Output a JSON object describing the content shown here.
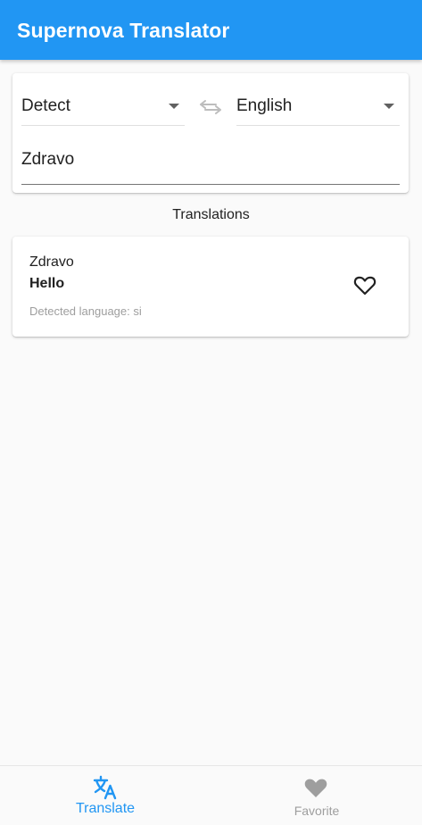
{
  "app": {
    "title": "Supernova Translator"
  },
  "translator": {
    "source_language": "Detect",
    "target_language": "English",
    "input_text": "Zdravo"
  },
  "translations": {
    "title": "Translations",
    "items": [
      {
        "source": "Zdravo",
        "translation": "Hello",
        "detected": "Detected language: si",
        "favorite": false
      }
    ]
  },
  "bottom_nav": {
    "items": [
      {
        "label": "Translate",
        "icon": "translate-icon",
        "active": true
      },
      {
        "label": "Favorite",
        "icon": "heart-icon",
        "active": false
      }
    ]
  },
  "colors": {
    "primary": "#2196f3",
    "inactive": "#9e9e9e"
  }
}
